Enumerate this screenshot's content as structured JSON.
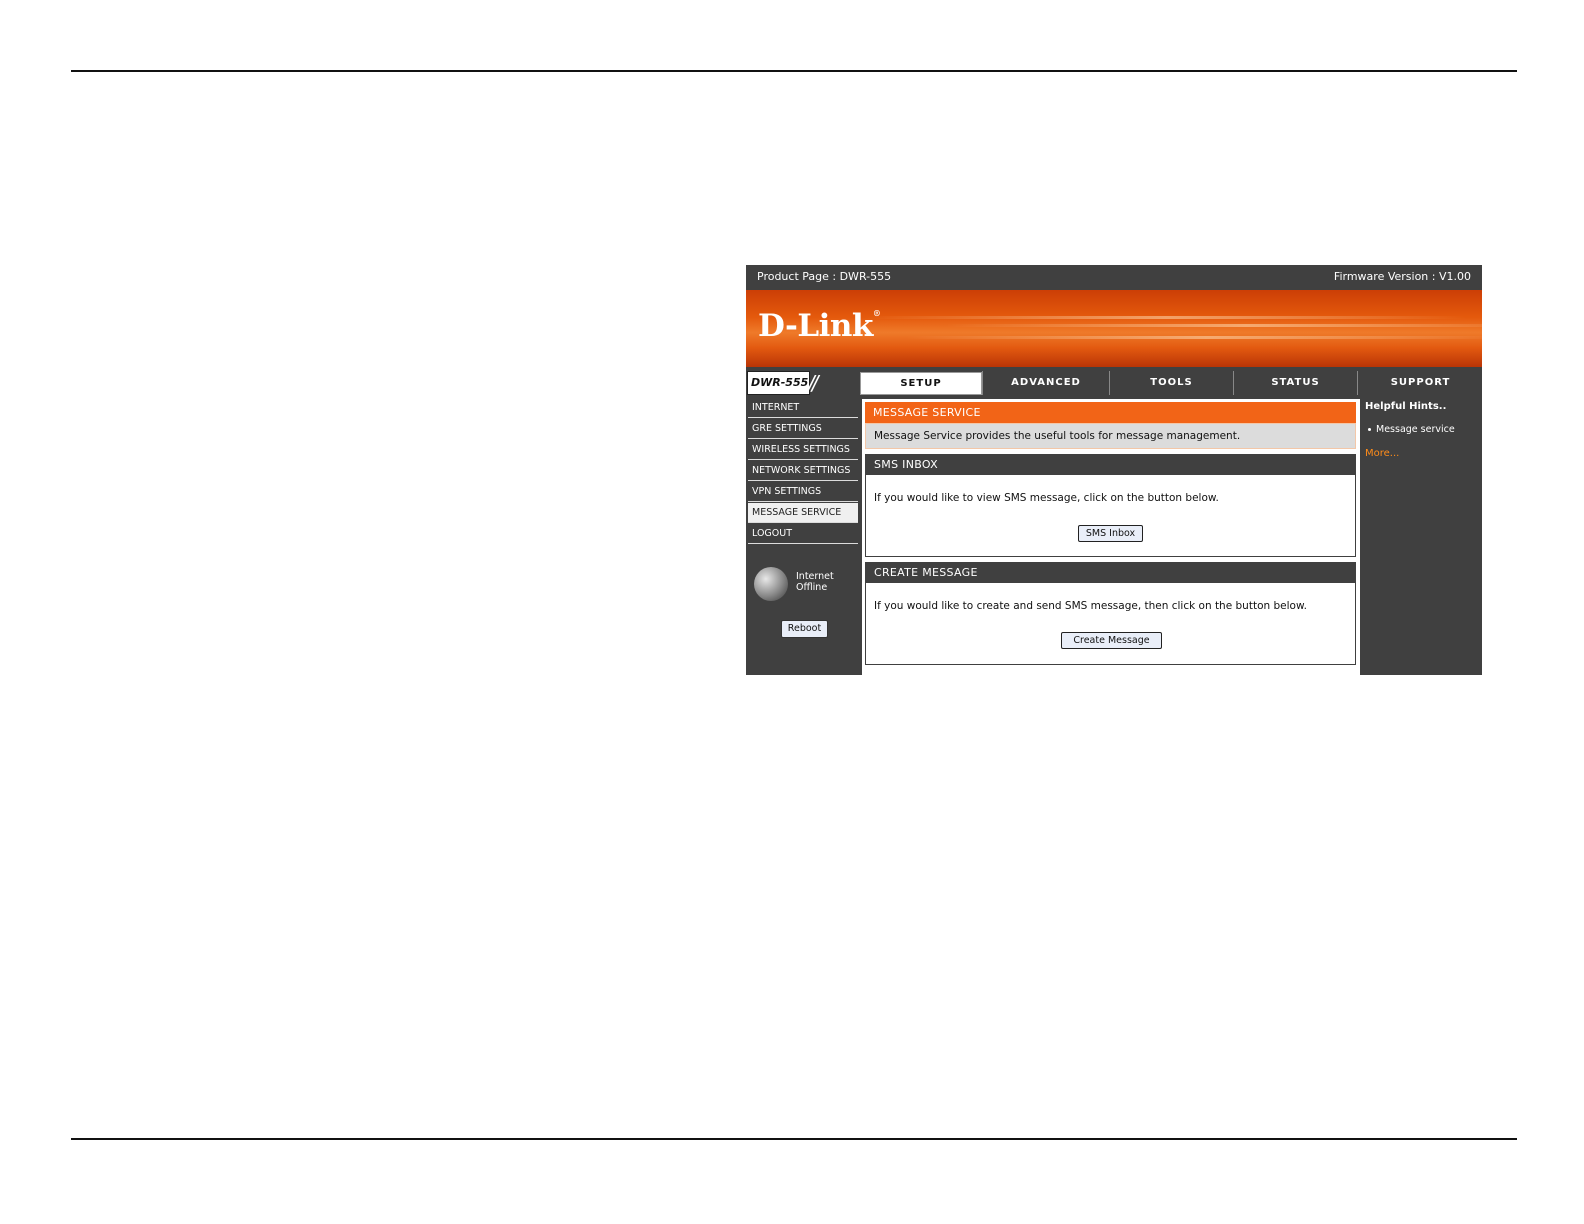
{
  "header": {
    "product_page": "Product Page :  DWR-555",
    "firmware": "Firmware Version : V1.00"
  },
  "brand": {
    "logo_text": "D-Link",
    "trademark": "®",
    "model": "DWR-555"
  },
  "tabs": [
    {
      "label": "SETUP",
      "active": true
    },
    {
      "label": "ADVANCED",
      "active": false
    },
    {
      "label": "TOOLS",
      "active": false
    },
    {
      "label": "STATUS",
      "active": false
    },
    {
      "label": "SUPPORT",
      "active": false
    }
  ],
  "sidebar": {
    "items": [
      {
        "label": "INTERNET"
      },
      {
        "label": "GRE SETTINGS"
      },
      {
        "label": "WIRELESS SETTINGS"
      },
      {
        "label": "NETWORK SETTINGS"
      },
      {
        "label": "VPN SETTINGS"
      },
      {
        "label": "MESSAGE SERVICE",
        "active": true
      },
      {
        "label": "LOGOUT"
      }
    ],
    "status_line1": "Internet",
    "status_line2": "Offline",
    "reboot_label": "Reboot"
  },
  "main": {
    "title": "MESSAGE SERVICE",
    "description": "Message Service provides the useful tools for message management.",
    "inbox": {
      "title": "SMS INBOX",
      "text": "If you would like to view SMS message, click on the button below.",
      "button": "SMS Inbox"
    },
    "create": {
      "title": "CREATE MESSAGE",
      "text": "If you would like to create and send SMS message, then click on the button below.",
      "button": "Create Message"
    }
  },
  "hints": {
    "title": "Helpful Hints..",
    "items": [
      "Message service"
    ],
    "more": "More..."
  },
  "colors": {
    "accent": "#f26417",
    "panel": "#404040",
    "link": "#ff8c1a"
  }
}
